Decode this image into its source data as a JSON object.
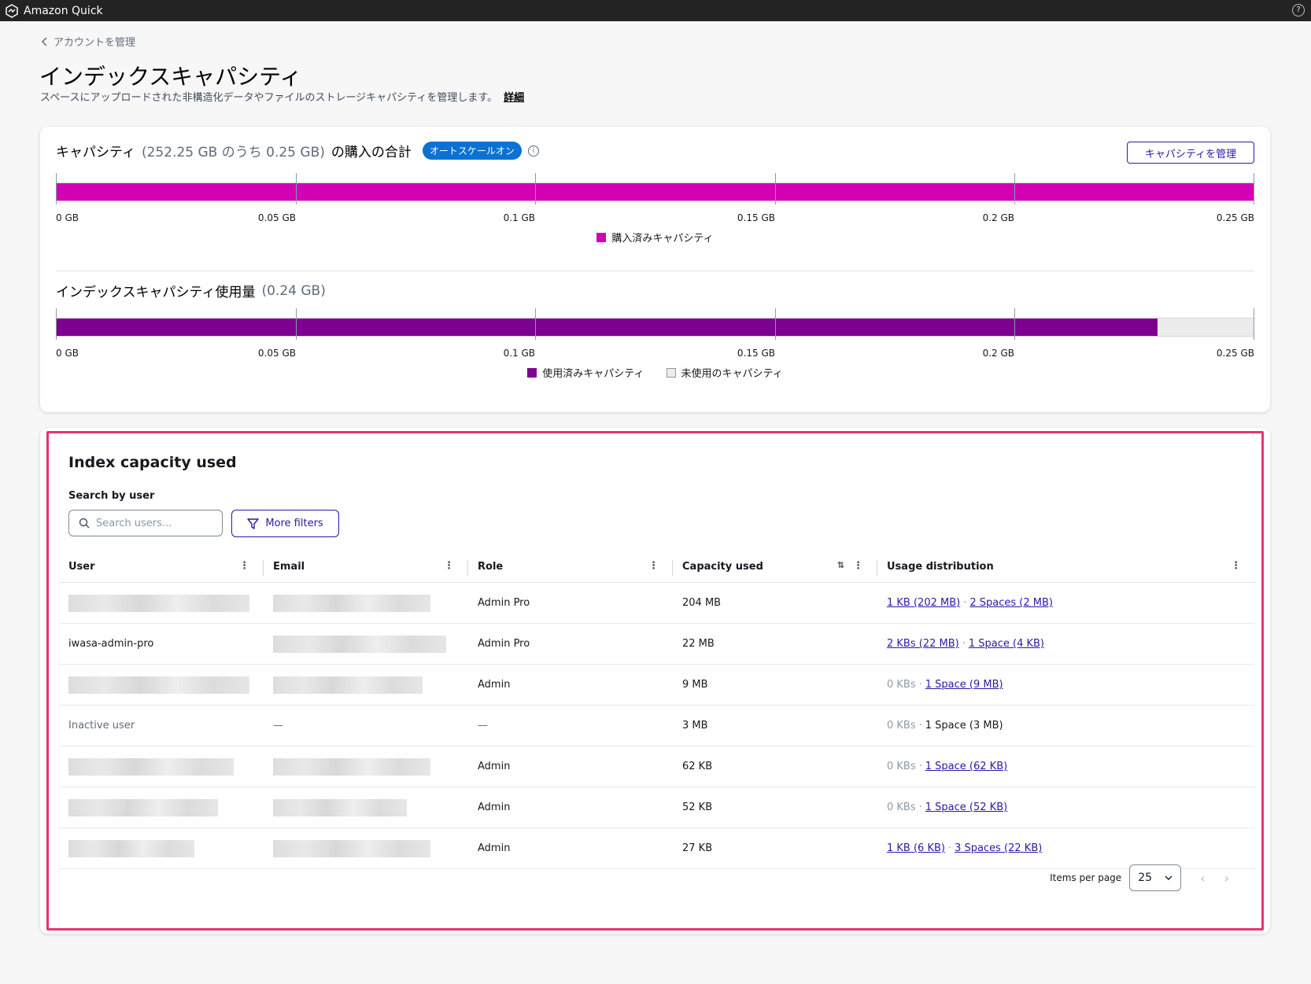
{
  "topbar": {
    "app_title": "Amazon Quick",
    "logo_icon": "quick-logo-icon",
    "help_icon": "help-icon"
  },
  "breadcrumb": {
    "label": "アカウントを管理"
  },
  "page": {
    "title": "インデックスキャパシティ",
    "description": "スペースにアップロードされた非構造化データやファイルのストレージキャパシティを管理します。",
    "detail_link": "詳細"
  },
  "capacity": {
    "title_main": "キャパシティ",
    "title_muted": "(252.25 GB のうち 0.25 GB)",
    "title_suffix": "の購入の合計",
    "badge": "オートスケールオン",
    "manage_button": "キャパシティを管理",
    "purchased_fraction": 1.0,
    "ticks": [
      "0 GB",
      "0.05 GB",
      "0.1 GB",
      "0.15 GB",
      "0.2 GB",
      "0.25 GB"
    ],
    "legend_purchased": "購入済みキャパシティ",
    "color_purchased": "#d300b4"
  },
  "usage": {
    "title_main": "インデックスキャパシティ使用量",
    "title_muted": "(0.24 GB)",
    "used_fraction": 0.92,
    "ticks": [
      "0 GB",
      "0.05 GB",
      "0.1 GB",
      "0.15 GB",
      "0.2 GB",
      "0.25 GB"
    ],
    "legend_used": "使用済みキャパシティ",
    "legend_unused": "未使用のキャパシティ",
    "color_used": "#7d0090",
    "color_unused": "#ececec"
  },
  "index_table": {
    "title": "Index capacity used",
    "search_label": "Search by user",
    "search_placeholder": "Search users...",
    "filter_button": "More filters",
    "columns": [
      "User",
      "Email",
      "Role",
      "Capacity used",
      "Usage distribution"
    ],
    "rows": [
      {
        "user": "",
        "email": "",
        "role": "Admin Pro",
        "capacity": "204 MB",
        "kb": "1 KB (202 MB)",
        "kb_link": true,
        "spaces": "2 Spaces (2 MB)",
        "spaces_link": true
      },
      {
        "user": "iwasa-admin-pro",
        "email": "",
        "role": "Admin Pro",
        "capacity": "22 MB",
        "kb": "2 KBs (22 MB)",
        "kb_link": true,
        "spaces": "1 Space (4 KB)",
        "spaces_link": true
      },
      {
        "user": "",
        "email": "",
        "role": "Admin",
        "capacity": "9 MB",
        "kb": "0 KBs",
        "kb_link": false,
        "spaces": "1 Space (9 MB)",
        "spaces_link": true
      },
      {
        "user": "Inactive user",
        "email": "—",
        "role": "—",
        "capacity": "3 MB",
        "kb": "0 KBs",
        "kb_link": false,
        "spaces": "1 Space (3 MB)",
        "spaces_link": false
      },
      {
        "user": "",
        "email": "",
        "role": "Admin",
        "capacity": "62 KB",
        "kb": "0 KBs",
        "kb_link": false,
        "spaces": "1 Space (62 KB)",
        "spaces_link": true
      },
      {
        "user": "",
        "email": "",
        "role": "Admin",
        "capacity": "52 KB",
        "kb": "0 KBs",
        "kb_link": false,
        "spaces": "1 Space (52 KB)",
        "spaces_link": true
      },
      {
        "user": "",
        "email": "",
        "role": "Admin",
        "capacity": "27 KB",
        "kb": "1 KB (6 KB)",
        "kb_link": true,
        "spaces": "3 Spaces (22 KB)",
        "spaces_link": true
      }
    ],
    "pagination": {
      "items_per_page_label": "Items per page",
      "items_per_page": "25"
    }
  }
}
